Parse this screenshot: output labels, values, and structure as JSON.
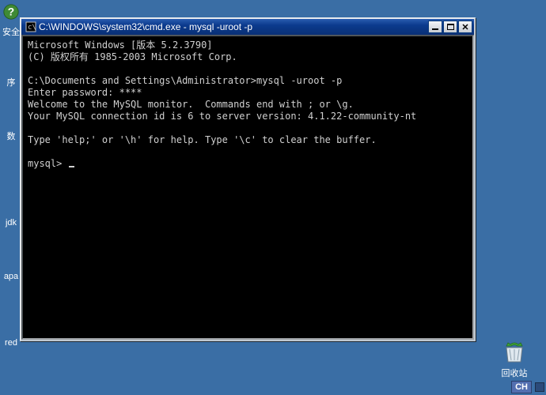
{
  "desktop": {
    "icon_help_alt": "help-icon",
    "label_sec": "安全",
    "label_order": "序",
    "label_num": "数",
    "label_jdk": "jdk",
    "label_apa": "apa",
    "label_red": "red",
    "recycle_label": "回收站"
  },
  "taskbar": {
    "ime_label": "CH"
  },
  "window": {
    "title": "C:\\WINDOWS\\system32\\cmd.exe - mysql -uroot -p"
  },
  "term": {
    "line1": "Microsoft Windows [版本 5.2.3790]",
    "line2": "(C) 版权所有 1985-2003 Microsoft Corp.",
    "blank1": "",
    "line3": "C:\\Documents and Settings\\Administrator>mysql -uroot -p",
    "line4": "Enter password: ****",
    "line5": "Welcome to the MySQL monitor.  Commands end with ; or \\g.",
    "line6": "Your MySQL connection id is 6 to server version: 4.1.22-community-nt",
    "blank2": "",
    "line7": "Type 'help;' or '\\h' for help. Type '\\c' to clear the buffer.",
    "blank3": "",
    "prompt": "mysql> "
  }
}
